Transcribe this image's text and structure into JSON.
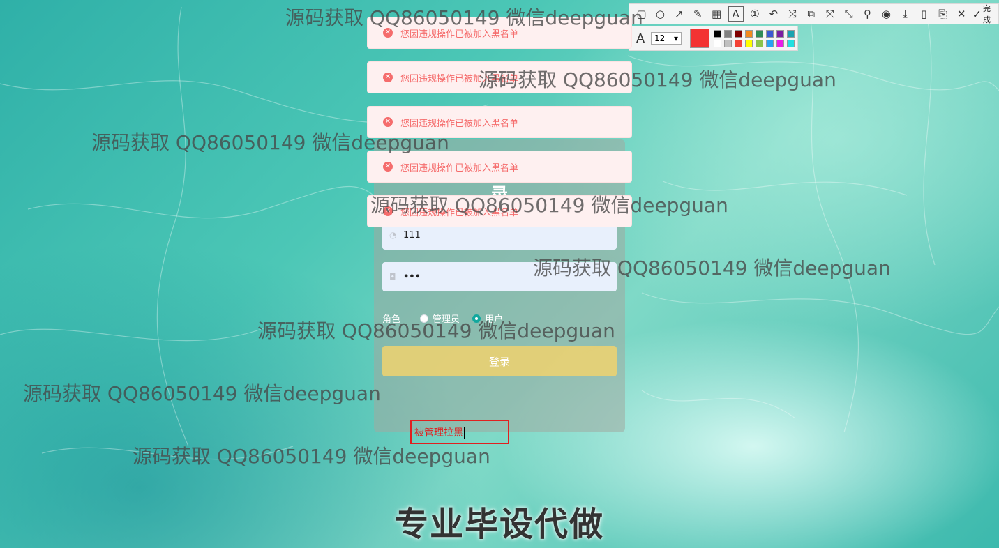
{
  "toolbar": {
    "icons": [
      "rectangle-icon",
      "ellipse-icon",
      "arrow-icon",
      "pencil-icon",
      "mosaic-icon",
      "text-icon",
      "number-marker-icon",
      "undo-icon",
      "redo-icon",
      "ocr-icon",
      "translate-icon",
      "expand-icon",
      "pin-icon",
      "record-icon",
      "download-icon",
      "copy-icon",
      "save-icon",
      "close-icon"
    ],
    "done_label": "完成",
    "font_size": "12",
    "current_color": "#f33333",
    "palette": [
      "#000000",
      "#808080",
      "#800000",
      "#f28a20",
      "#2e8b57",
      "#3a59d1",
      "#7b1fa2",
      "#1aa3b0",
      "#ffffff",
      "#c0c0c0",
      "#f44336",
      "#ffff00",
      "#8bc34a",
      "#29a3f2",
      "#e91ee8",
      "#22e0e0"
    ]
  },
  "messages": [
    {
      "text": "您因违规操作已被加入黑名单"
    },
    {
      "text": "您因违规操作已被加入黑名单"
    },
    {
      "text": "您因违规操作已被加入黑名单"
    },
    {
      "text": "您因违规操作已被加入黑名单"
    },
    {
      "text": "您因违规操作已被加入黑名单"
    }
  ],
  "login": {
    "title": "录",
    "username_value": "111",
    "password_value": "•••",
    "role_label": "角色",
    "role_admin": "管理员",
    "role_user": "用户",
    "submit_label": "登录"
  },
  "annotation": {
    "text": "被管理拉黑"
  },
  "watermarks": [
    "源码获取 QQ86050149 微信deepguan",
    "源码获取 QQ86050149 微信deepguan",
    "源码获取 QQ86050149 微信deepguan",
    "源码获取 QQ86050149 微信deepguan",
    "源码获取 QQ86050149 微信deepguan",
    "源码获取 QQ86050149 微信deepguan",
    "源码获取 QQ86050149 微信deepguan",
    "源码获取 QQ86050149 微信deepguan"
  ],
  "footer": "专业毕设代做"
}
